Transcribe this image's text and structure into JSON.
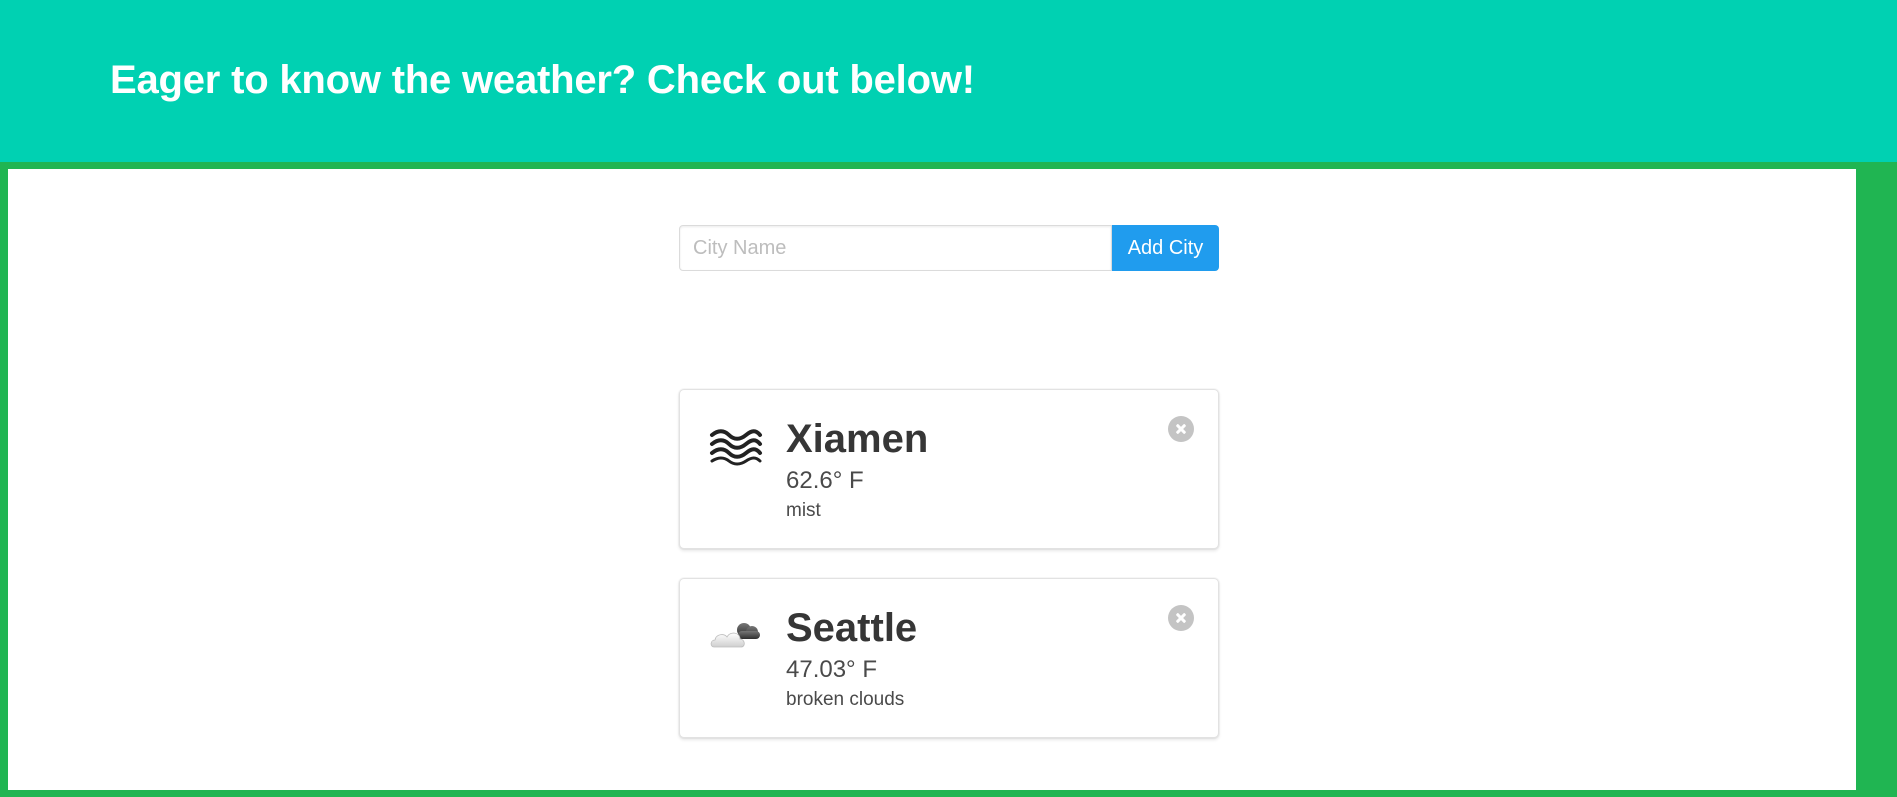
{
  "header": {
    "title": "Eager to know the weather? Check out below!"
  },
  "search": {
    "placeholder": "City Name",
    "value": "",
    "button_label": "Add City"
  },
  "cities": [
    {
      "name": "Xiamen",
      "temperature": "62.6° F",
      "description": "mist",
      "icon": "mist-icon"
    },
    {
      "name": "Seattle",
      "temperature": "47.03° F",
      "description": "broken clouds",
      "icon": "broken-clouds-icon"
    }
  ],
  "colors": {
    "hero_background": "#00d1b2",
    "page_border": "#20b552",
    "button_background": "#209cee",
    "delete_button": "#c4c4c4"
  }
}
